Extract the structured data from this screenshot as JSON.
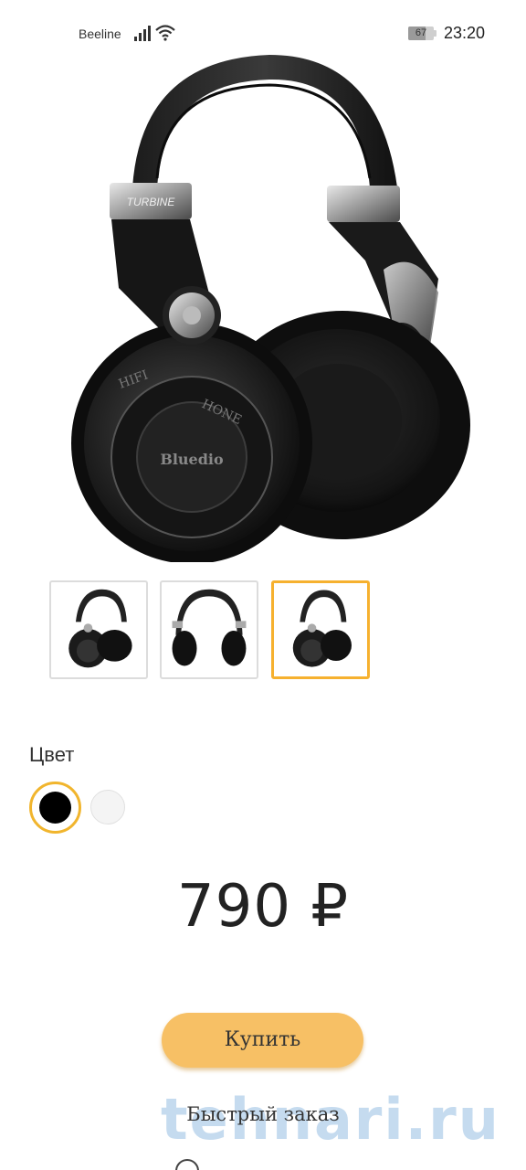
{
  "status_bar": {
    "carrier": "Beeline",
    "battery_level": "67",
    "battery_fraction": 0.67,
    "time": "23:20"
  },
  "product": {
    "image_label_turbine": "TURBINE",
    "image_label_brand": "Bluedio",
    "image_label_hifi": "HIFI",
    "image_label_phone": "HONE"
  },
  "thumbnails": [
    {
      "name": "headphones-angle-view",
      "selected": false
    },
    {
      "name": "headphones-front-view",
      "selected": false
    },
    {
      "name": "headphones-side-view",
      "selected": true
    }
  ],
  "color": {
    "label": "Цвет",
    "options": [
      {
        "name": "black",
        "hex": "#000000",
        "selected": true
      },
      {
        "name": "white",
        "hex": "#f4f4f4",
        "selected": false
      }
    ]
  },
  "price": "790 ₽",
  "buy_label": "Купить",
  "quick_order_label": "Быстрый заказ",
  "watermark": "tehnari.ru",
  "accent_color": "#f6b12f"
}
